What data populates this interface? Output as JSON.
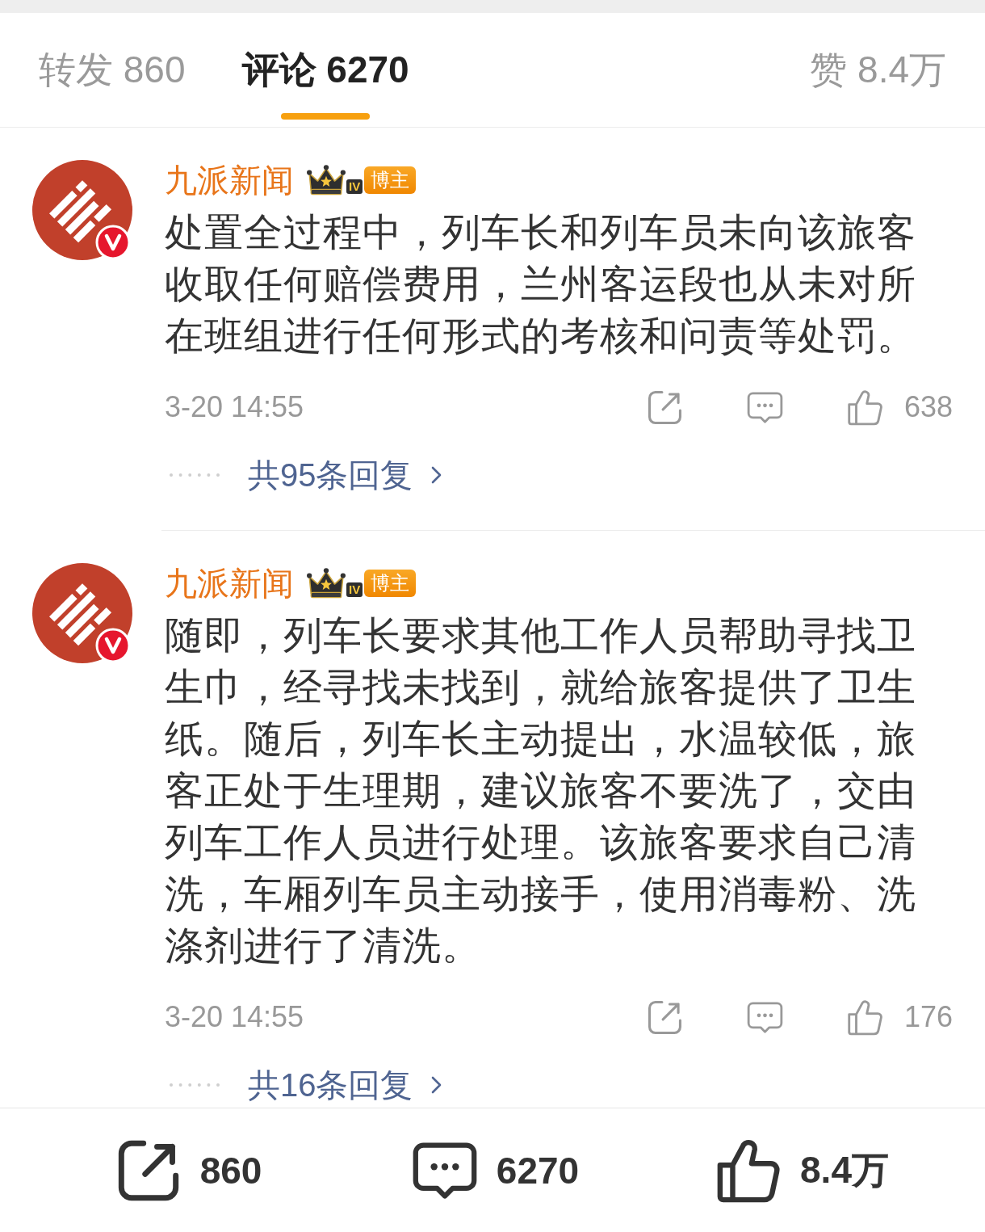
{
  "tabs": [
    {
      "label": "转发 860",
      "selected": false
    },
    {
      "label": "评论 6270",
      "selected": true
    }
  ],
  "likes_tab": {
    "label": "赞 8.4万"
  },
  "comments": [
    {
      "author": "九派新闻",
      "verified": true,
      "badge": {
        "rank": "IV",
        "label": "博主"
      },
      "text": "处置全过程中，列车长和列车员未向该旅客收取任何赔偿费用，兰州客运段也从未对所在班组进行任何形式的考核和问责等处罚。",
      "time": "3-20 14:55",
      "likes": "638",
      "replies": "共95条回复"
    },
    {
      "author": "九派新闻",
      "verified": true,
      "badge": {
        "rank": "IV",
        "label": "博主"
      },
      "text": "随即，列车长要求其他工作人员帮助寻找卫生巾，经寻找未找到，就给旅客提供了卫生纸。随后，列车长主动提出，水温较低，旅客正处于生理期，建议旅客不要洗了，交由列车工作人员进行处理。该旅客要求自己清洗，车厢列车员主动接手，使用消毒粉、洗涤剂进行了清洗。",
      "time": "3-20 14:55",
      "likes": "176",
      "replies": "共16条回复"
    }
  ],
  "bottom_bar": [
    {
      "kind": "share",
      "count": "860"
    },
    {
      "kind": "comment",
      "count": "6270"
    },
    {
      "kind": "like",
      "count": "8.4万"
    }
  ]
}
